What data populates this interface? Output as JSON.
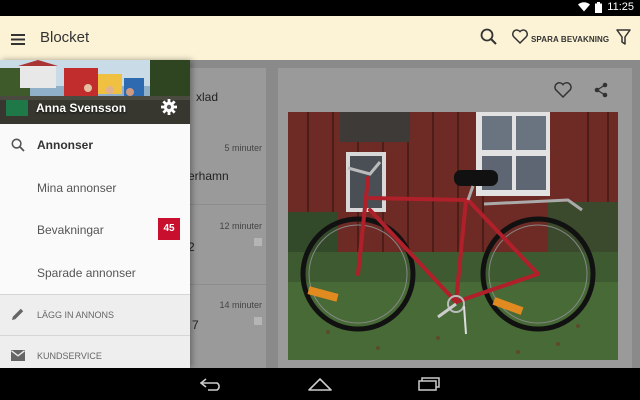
{
  "status_bar": {
    "time": "11:25",
    "icons": [
      "wifi-icon",
      "battery-icon"
    ]
  },
  "app_bar": {
    "title": "Blocket",
    "menu_icon": "hamburger-menu-icon",
    "search_icon": "search-icon",
    "save_watch_label": "SPARA BEVAKNING",
    "filter_icon": "filter-icon"
  },
  "drawer": {
    "user_name": "Anna Svensson",
    "settings_icon": "gear-icon",
    "items": [
      {
        "label": "Annonser",
        "icon": "search-icon",
        "active": true
      },
      {
        "label": "Mina annonser"
      },
      {
        "label": "Bevakningar",
        "count": "45"
      },
      {
        "label": "Sparade annonser"
      }
    ],
    "secondary": [
      {
        "label": "LÄGG IN ANNONS",
        "icon": "pencil-icon"
      },
      {
        "label": "KUNDSERVICE",
        "icon": "mail-icon"
      }
    ]
  },
  "listing_panel": {
    "partial_texts": [
      "xlad",
      "erhamn",
      "2",
      "7"
    ],
    "times": [
      "5 minuter",
      "12 minuter",
      "14 minuter"
    ]
  },
  "detail_panel": {
    "favorite_icon": "heart-icon",
    "share_icon": "share-icon"
  },
  "nav_bar": {
    "icons": [
      "back-icon",
      "home-icon",
      "recents-icon"
    ]
  },
  "colors": {
    "app_bar_bg": "#fcf3d6",
    "badge_red": "#c8102e"
  }
}
